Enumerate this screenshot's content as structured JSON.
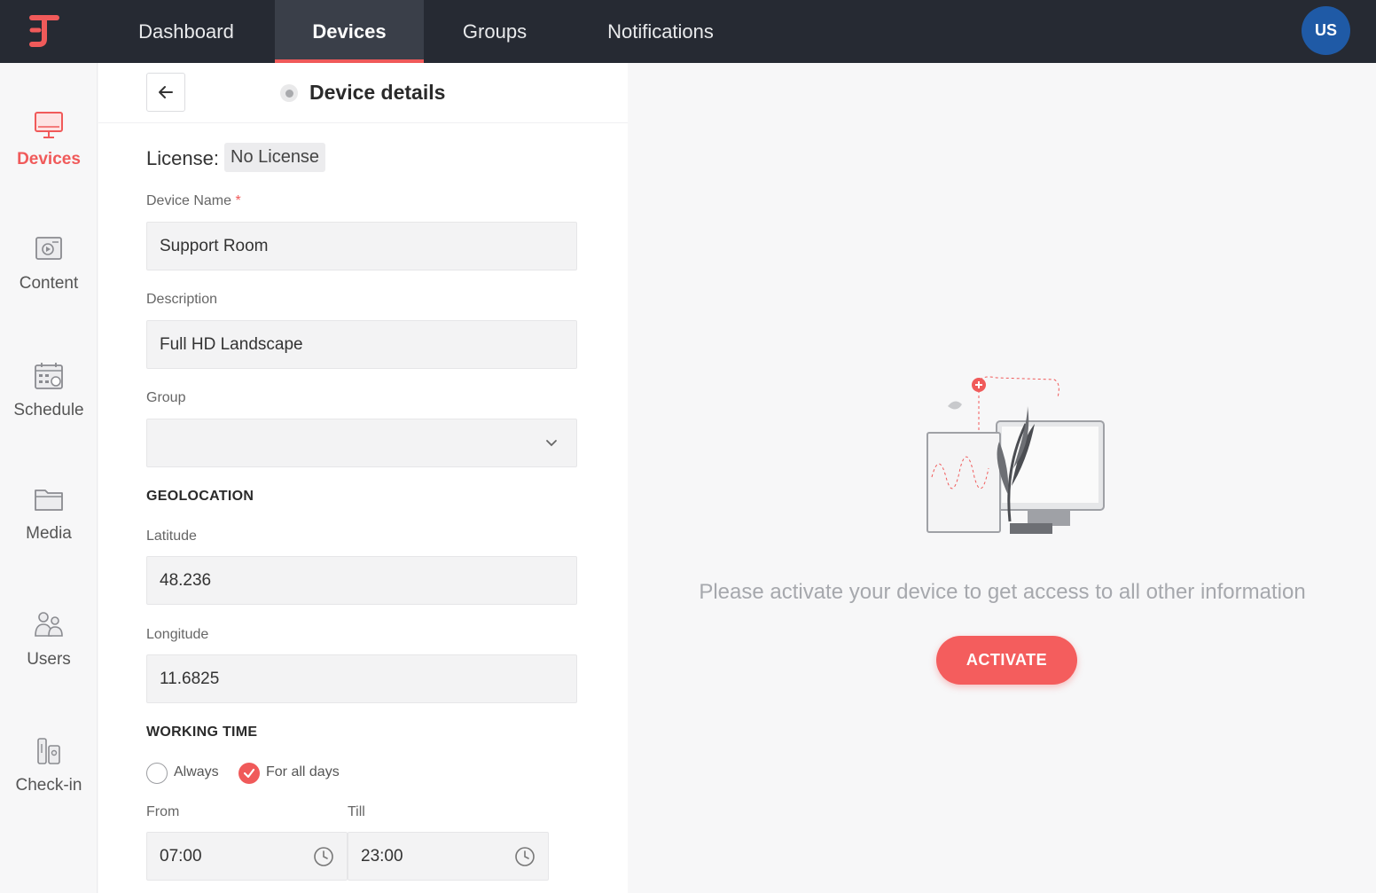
{
  "topnav": {
    "items": [
      {
        "label": "Dashboard"
      },
      {
        "label": "Devices"
      },
      {
        "label": "Groups"
      },
      {
        "label": "Notifications"
      }
    ],
    "active": "Devices",
    "avatar_initials": "US"
  },
  "sidebar": {
    "items": [
      {
        "label": "Devices",
        "icon": "monitor-icon"
      },
      {
        "label": "Content",
        "icon": "content-icon"
      },
      {
        "label": "Schedule",
        "icon": "calendar-icon"
      },
      {
        "label": "Media",
        "icon": "folder-icon"
      },
      {
        "label": "Users",
        "icon": "users-icon"
      },
      {
        "label": "Check-in",
        "icon": "check-in-icon"
      }
    ],
    "active": "Devices"
  },
  "panel": {
    "title": "Device details",
    "license_label": "License:",
    "license_value": "No License",
    "device_name_label": "Device Name",
    "device_name_required": "*",
    "device_name_value": "Support Room",
    "description_label": "Description",
    "description_value": "Full HD Landscape",
    "group_label": "Group",
    "group_value": "",
    "geolocation_title": "GEOLOCATION",
    "latitude_label": "Latitude",
    "latitude_value": "48.236",
    "longitude_label": "Longitude",
    "longitude_value": "11.6825",
    "working_time_title": "WORKING TIME",
    "radio_always": "Always",
    "radio_all_days": "For all days",
    "selected_radio": "For all days",
    "from_label": "From",
    "from_value": "07:00",
    "till_label": "Till",
    "till_value": "23:00"
  },
  "right": {
    "message": "Please activate your device to get access to all other information",
    "activate_label": "ACTIVATE"
  },
  "colors": {
    "topbar": "#262a33",
    "accent": "#f05a5a",
    "avatar": "#1f5aa6"
  }
}
